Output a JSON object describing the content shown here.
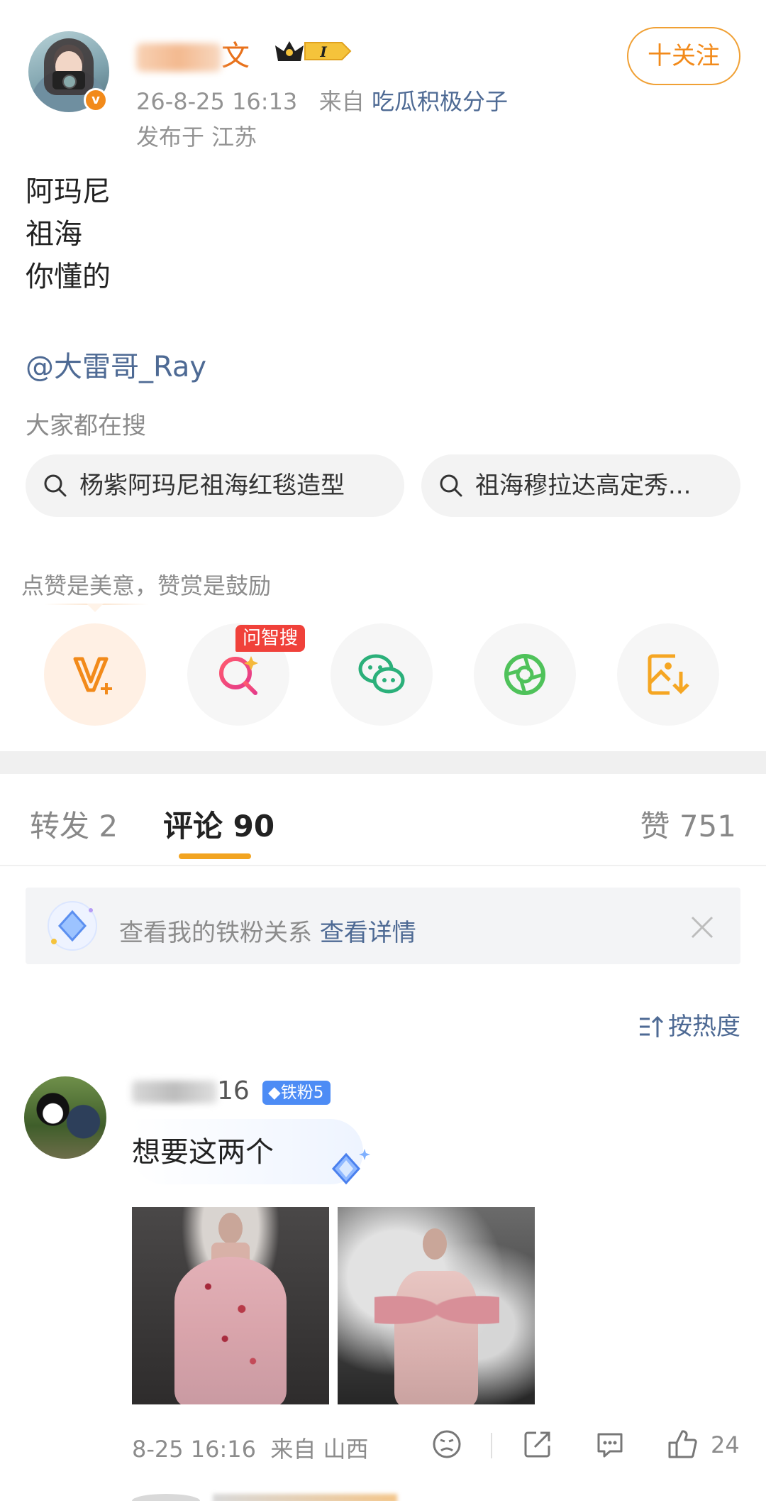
{
  "post": {
    "author": {
      "name_visible": "文",
      "verified": "v"
    },
    "crown_level": "I",
    "time": "26-8-25 16:13",
    "source_prefix": "来自",
    "source": "吃瓜积极分子",
    "location": "发布于 江苏",
    "follow_label": "十关注",
    "text_lines": [
      "阿玛尼",
      "祖海",
      "你懂的"
    ],
    "mention": "@大雷哥_Ray"
  },
  "search": {
    "title": "大家都在搜",
    "chips": [
      "杨紫阿玛尼祖海红毯造型",
      "祖海穆拉达高定秀..."
    ]
  },
  "actions": {
    "reward_tip": "点赞是美意，赞赏是鼓励",
    "items": [
      "v-plus-icon",
      "ai-search-icon",
      "wechat-icon",
      "moments-icon",
      "save-image-icon"
    ],
    "ai_badge": "问智搜"
  },
  "tabs": {
    "repost": "转发 2",
    "comment": "评论 90",
    "like": "赞 751"
  },
  "fans_bar": {
    "text": "查看我的铁粉关系",
    "link": "查看详情"
  },
  "sort_label": "按热度",
  "comment": {
    "name_visible": "16",
    "badge": "铁粉5",
    "text": "想要这两个",
    "time": "8-25 16:16",
    "location": "来自 山西",
    "likes": "24"
  },
  "colors": {
    "accent": "#f28a1a",
    "link": "#4e6a94",
    "tab_underline": "#f2a421"
  }
}
